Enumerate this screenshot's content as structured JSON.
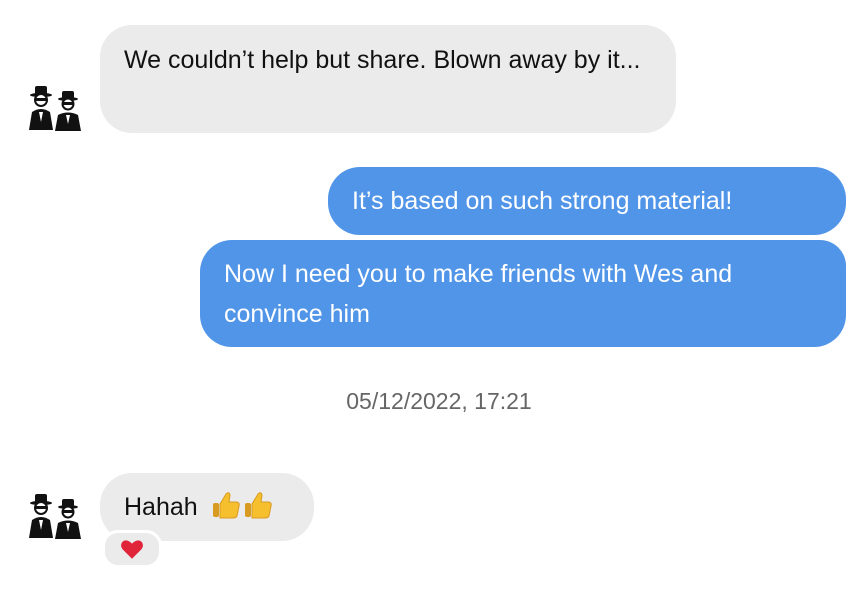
{
  "chat": {
    "messages": [
      {
        "direction": "incoming",
        "text": "We couldn’t help but share. Blown away by it..."
      },
      {
        "direction": "outgoing",
        "text": "It’s based on such strong material!"
      },
      {
        "direction": "outgoing",
        "text": "Now I need you to make friends with Wes and convince him"
      },
      {
        "direction": "incoming",
        "text": "Hahah",
        "emoji": "thumbs-up thumbs-up",
        "reaction": "red-heart"
      }
    ],
    "timestamp": "05/12/2022, 17:21"
  },
  "colors": {
    "incoming_bubble": "#ebebeb",
    "outgoing_bubble": "#5195e8",
    "timestamp_text": "#666666",
    "reaction_heart": "#e0243a"
  },
  "icons": {
    "avatar": "two-men-in-hats-avatar",
    "emoji": "thumbs-up-emoji",
    "reaction": "red-heart-icon"
  }
}
